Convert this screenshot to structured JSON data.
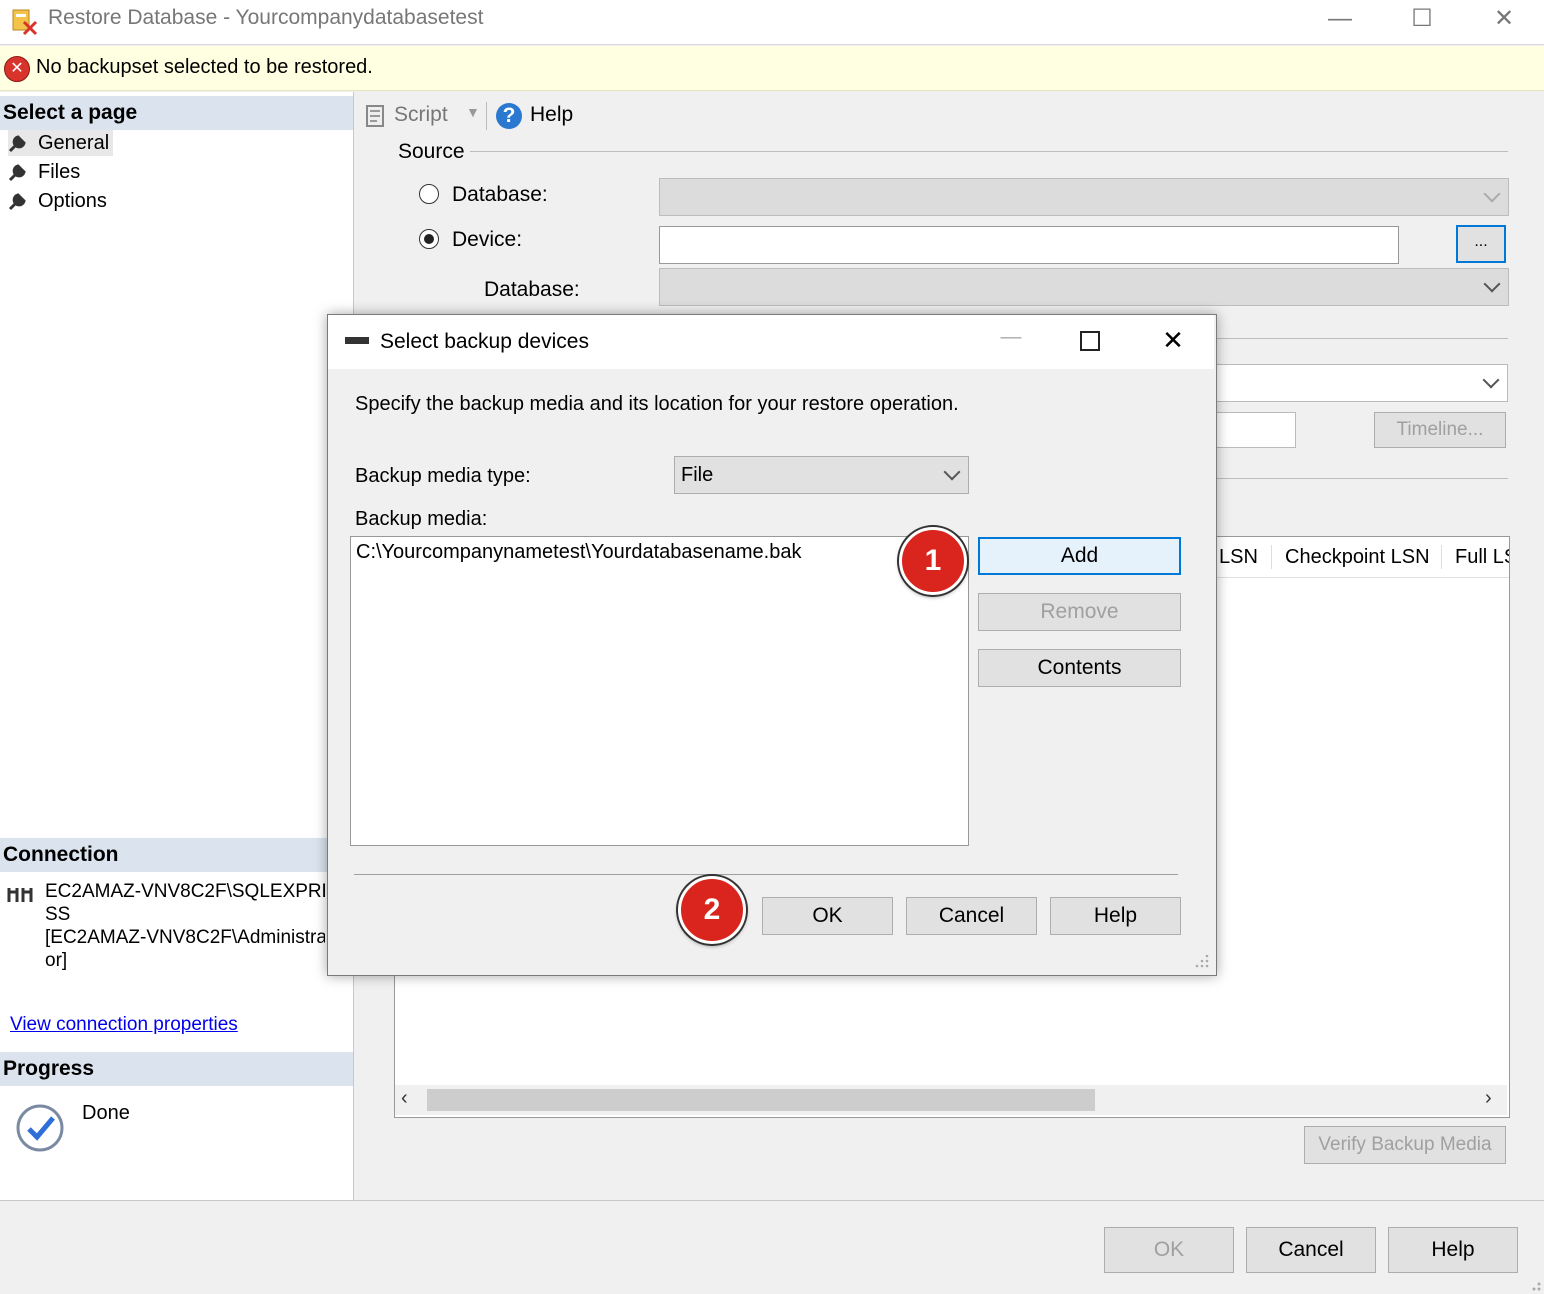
{
  "window": {
    "title": "Restore Database - Yourcompanydatabasetest",
    "minimize": "—",
    "maximize": "☐",
    "close": "✕"
  },
  "warning": {
    "message": "No backupset selected to be restored."
  },
  "left_pane": {
    "select_page_header": "Select a page",
    "pages": [
      {
        "label": "General"
      },
      {
        "label": "Files"
      },
      {
        "label": "Options"
      }
    ],
    "connection_header": "Connection",
    "connection_lines": [
      "EC2AMAZ-VNV8C2F\\SQLEXPRE",
      "SS",
      "[EC2AMAZ-VNV8C2F\\Administrat",
      "or]"
    ],
    "view_connection_link": "View connection properties",
    "progress_header": "Progress",
    "progress_status": "Done"
  },
  "toolbar": {
    "script_label": "Script",
    "help_label": "Help"
  },
  "source": {
    "group_label": "Source",
    "database_radio_label": "Database:",
    "device_radio_label": "Device:",
    "device_browse_label": "...",
    "database_label": "Database:",
    "selected_source": "Device"
  },
  "destination": {
    "timeline_button": "Timeline..."
  },
  "backup_grid": {
    "columns": [
      "LSN",
      "Checkpoint LSN",
      "Full LS"
    ]
  },
  "footer": {
    "verify_button": "Verify Backup Media",
    "ok": "OK",
    "cancel": "Cancel",
    "help": "Help"
  },
  "dialog": {
    "title": "Select backup devices",
    "instructions": "Specify the backup media and its location for your restore operation.",
    "media_type_label": "Backup media type:",
    "media_type_value": "File",
    "media_label": "Backup media:",
    "media_items": [
      "C:\\Yourcompanynametest\\Yourdatabasename.bak"
    ],
    "add_button": "Add",
    "remove_button": "Remove",
    "contents_button": "Contents",
    "ok": "OK",
    "cancel": "Cancel",
    "help": "Help"
  },
  "annotations": {
    "step1": "1",
    "step2": "2"
  },
  "colors": {
    "accent": "#0078d7",
    "badge_red": "#d9251d",
    "warning_bg": "#ffffe1",
    "section_header_bg": "#dbe3ee"
  }
}
